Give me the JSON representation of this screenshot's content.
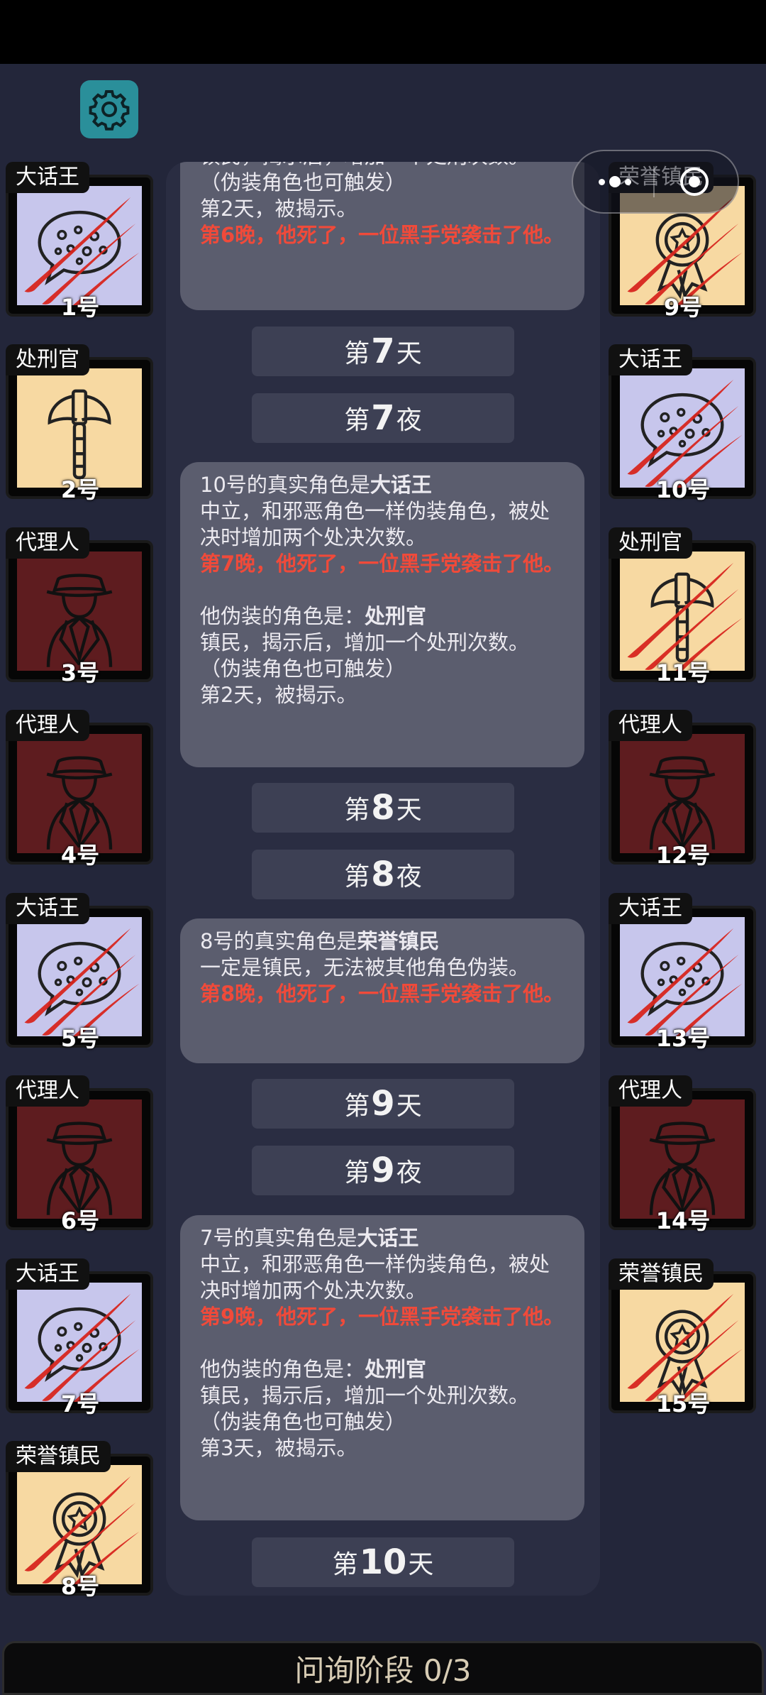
{
  "header": {
    "settings_icon": "gear-icon",
    "capsule_icons": [
      "more-dots-icon",
      "close-circle-icon"
    ]
  },
  "left_players": [
    {
      "role": "大话王",
      "number": "1号",
      "role_type": "chatterbox",
      "dead": true
    },
    {
      "role": "处刑官",
      "number": "2号",
      "role_type": "executioner",
      "dead": false
    },
    {
      "role": "代理人",
      "number": "3号",
      "role_type": "agent",
      "dead": false
    },
    {
      "role": "代理人",
      "number": "4号",
      "role_type": "agent",
      "dead": false
    },
    {
      "role": "大话王",
      "number": "5号",
      "role_type": "chatterbox",
      "dead": true
    },
    {
      "role": "代理人",
      "number": "6号",
      "role_type": "agent",
      "dead": false
    },
    {
      "role": "大话王",
      "number": "7号",
      "role_type": "chatterbox",
      "dead": true
    },
    {
      "role": "荣誉镇民",
      "number": "8号",
      "role_type": "honor",
      "dead": true
    }
  ],
  "right_players": [
    {
      "role": "荣誉镇民",
      "number": "9号",
      "role_type": "honor",
      "dead": true
    },
    {
      "role": "大话王",
      "number": "10号",
      "role_type": "chatterbox",
      "dead": true
    },
    {
      "role": "处刑官",
      "number": "11号",
      "role_type": "executioner",
      "dead": true
    },
    {
      "role": "代理人",
      "number": "12号",
      "role_type": "agent",
      "dead": false
    },
    {
      "role": "大话王",
      "number": "13号",
      "role_type": "chatterbox",
      "dead": true
    },
    {
      "role": "代理人",
      "number": "14号",
      "role_type": "agent",
      "dead": false
    },
    {
      "role": "荣誉镇民",
      "number": "15号",
      "role_type": "honor",
      "dead": true
    }
  ],
  "log": [
    {
      "kind": "bubble",
      "lines": [
        {
          "text": "镇民，揭示后，增加一个处刑次数。"
        },
        {
          "text": "（伪装角色也可触发）"
        },
        {
          "text": "第2天，被揭示。"
        },
        {
          "text": "第6晚，他死了，一位黑手党袭击了他。",
          "red": true
        }
      ]
    },
    {
      "kind": "phase",
      "prefix": "第",
      "num": "7",
      "suffix": "天"
    },
    {
      "kind": "phase",
      "prefix": "第",
      "num": "7",
      "suffix": "夜"
    },
    {
      "kind": "bubble",
      "lines": [
        {
          "text": "10号的真实角色是",
          "bold": "大话王"
        },
        {
          "text": "中立，和邪恶角色一样伪装角色，被处决时增加两个处决次数。"
        },
        {
          "text": "第7晚，他死了，一位黑手党袭击了他。",
          "red": true
        },
        {
          "text": ""
        },
        {
          "text": "他伪装的角色是：",
          "bold": "处刑官"
        },
        {
          "text": "镇民，揭示后，增加一个处刑次数。"
        },
        {
          "text": "（伪装角色也可触发）"
        },
        {
          "text": "第2天，被揭示。"
        }
      ]
    },
    {
      "kind": "phase",
      "prefix": "第",
      "num": "8",
      "suffix": "天"
    },
    {
      "kind": "phase",
      "prefix": "第",
      "num": "8",
      "suffix": "夜"
    },
    {
      "kind": "bubble",
      "lines": [
        {
          "text": "8号的真实角色是",
          "bold": "荣誉镇民"
        },
        {
          "text": "一定是镇民，无法被其他角色伪装。"
        },
        {
          "text": "第8晚，他死了，一位黑手党袭击了他。",
          "red": true
        }
      ]
    },
    {
      "kind": "phase",
      "prefix": "第",
      "num": "9",
      "suffix": "天"
    },
    {
      "kind": "phase",
      "prefix": "第",
      "num": "9",
      "suffix": "夜"
    },
    {
      "kind": "bubble",
      "lines": [
        {
          "text": "7号的真实角色是",
          "bold": "大话王"
        },
        {
          "text": "中立，和邪恶角色一样伪装角色，被处决时增加两个处决次数。"
        },
        {
          "text": "第9晚，他死了，一位黑手党袭击了他。",
          "red": true
        },
        {
          "text": ""
        },
        {
          "text": "他伪装的角色是：",
          "bold": "处刑官"
        },
        {
          "text": "镇民，揭示后，增加一个处刑次数。"
        },
        {
          "text": "（伪装角色也可触发）"
        },
        {
          "text": "第3天，被揭示。"
        }
      ]
    },
    {
      "kind": "phase",
      "prefix": "第",
      "num": "10",
      "suffix": "天"
    }
  ],
  "bottom_bar": {
    "text": "问询阶段 0/3"
  },
  "colors": {
    "background": "#23263a",
    "log_panel": "#2a2d42",
    "bubble": "#5b5d6e",
    "phase": "#3d4054",
    "death_text": "#f04a3a",
    "chatterbox_bg": "#c7c6ec",
    "honor_bg": "#f7d9a2",
    "executioner_bg": "#f7d9a2",
    "agent_bg": "#5e1c1f",
    "slash": "#d8261f"
  }
}
